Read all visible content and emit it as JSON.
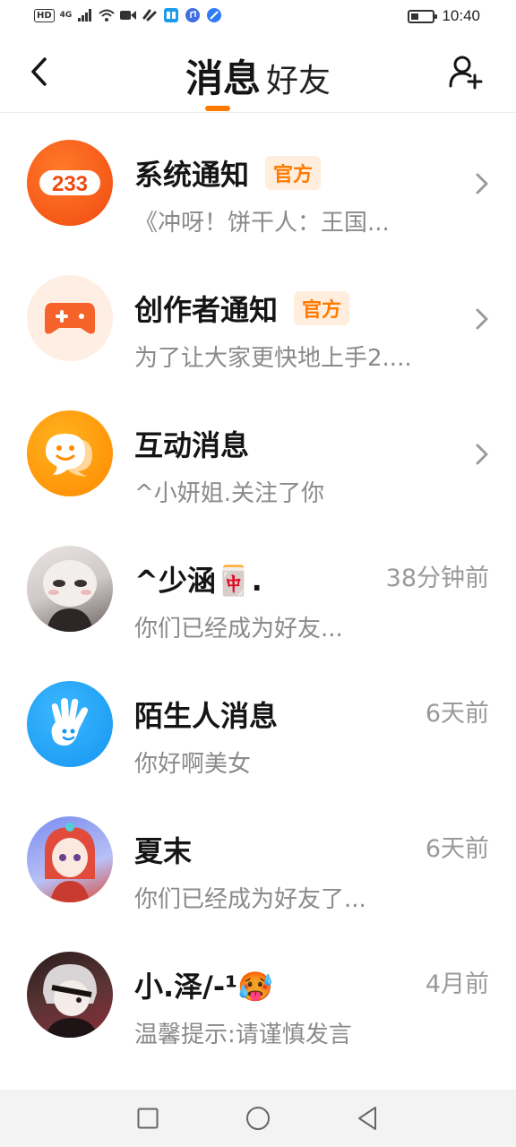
{
  "status_bar": {
    "hd_label": "HD",
    "network_label": "4G",
    "battery_level": 0.3,
    "time": "10:40"
  },
  "header": {
    "tabs": [
      {
        "label": "消息",
        "active": true
      },
      {
        "label": "好友",
        "active": false
      }
    ],
    "accent_color": "#ff7a00"
  },
  "conversations": [
    {
      "title": "系统通知",
      "badge": "官方",
      "subtitle": "《冲呀！饼干人：王国...",
      "time": "",
      "avatar": "logo-233-icon"
    },
    {
      "title": "创作者通知",
      "badge": "官方",
      "subtitle": "为了让大家更快地上手2....",
      "time": "",
      "avatar": "gamepad-icon"
    },
    {
      "title": "互动消息",
      "badge": "",
      "subtitle": "^小妍姐.关注了你",
      "time": "",
      "avatar": "chat-bubble-icon"
    },
    {
      "title": "^少涵🀄.",
      "badge": "",
      "subtitle": "你们已经成为好友...",
      "time": "38分钟前",
      "avatar": "user-avatar"
    },
    {
      "title": "陌生人消息",
      "badge": "",
      "subtitle": "你好啊美女",
      "time": "6天前",
      "avatar": "hand-wave-icon"
    },
    {
      "title": "夏末",
      "badge": "",
      "subtitle": "你们已经成为好友了...",
      "time": "6天前",
      "avatar": "user-avatar"
    },
    {
      "title": "小.泽/-¹🥵",
      "badge": "",
      "subtitle": "温馨提示:请谨慎发言",
      "time": "4月前",
      "avatar": "user-avatar"
    }
  ],
  "nav": {
    "buttons": [
      "recent-apps-icon",
      "home-icon",
      "back-triangle-icon"
    ]
  }
}
